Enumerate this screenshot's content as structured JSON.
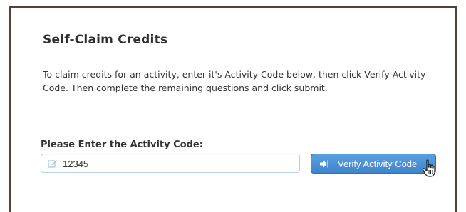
{
  "panel": {
    "title": "Self-Claim Credits",
    "description": "To claim credits for an activity, enter it's Activity Code below, then click Verify Activity Code. Then complete the remaining questions and click submit."
  },
  "form": {
    "label": "Please Enter the Activity Code:",
    "code_value": "12345",
    "input_icon": "edit-icon",
    "button_label": "Verify Activity Code",
    "button_icon": "sign-in-icon"
  },
  "colors": {
    "frame_border": "#5a3e33",
    "button_bg": "#4a8fd4",
    "input_border": "#b9d0ea"
  },
  "cursor": "hand-pointer"
}
